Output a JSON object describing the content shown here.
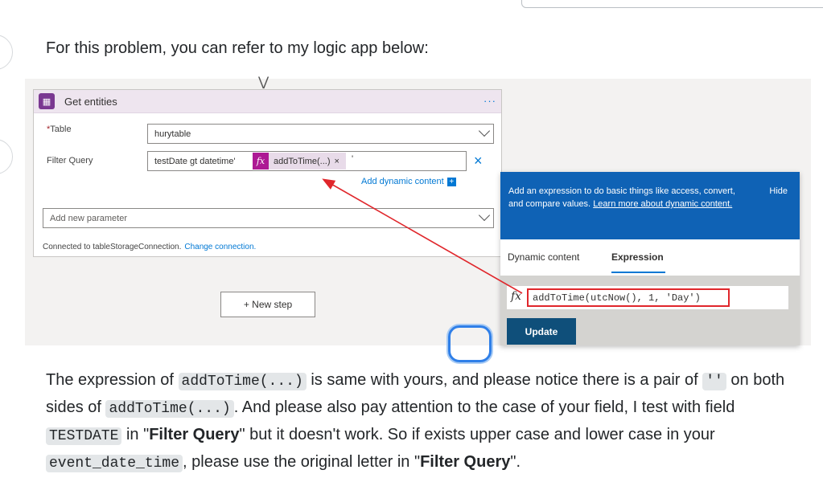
{
  "intro": "For this problem, you can refer to my logic app below:",
  "card": {
    "title": "Get entities",
    "more": "···",
    "table_required": "*",
    "table_label": "Table",
    "table_value": "hurytable",
    "filter_label": "Filter Query",
    "filter_prefix": "testDate gt datetime'",
    "token_fx": "fx",
    "token_label": "addToTime(...)",
    "token_close": "×",
    "filter_suffix": "'",
    "clear": "×",
    "add_dynamic": "Add dynamic content",
    "add_dynamic_plus": "+",
    "param_placeholder": "Add new parameter",
    "connected_text": "Connected to tableStorageConnection.",
    "change_connection": "Change connection."
  },
  "new_step": "+ New step",
  "panel": {
    "banner_text": "Add an expression to do basic things like access, convert, and compare values.",
    "learn_more": "Learn more about dynamic content.",
    "hide": "Hide",
    "tab_dynamic": "Dynamic content",
    "tab_expression": "Expression",
    "fx": "fx",
    "expression": "addToTime(utcNow(), 1, 'Day')",
    "update": "Update"
  },
  "paragraph": {
    "p1": "The expression of ",
    "c1": "addToTime(...)",
    "p2": " is same with yours, and please notice there is a pair of ",
    "c2": "''",
    "p3": " on both sides of ",
    "c3": "addToTime(...)",
    "p4": ". And please also pay attention to the case of your field, I test with field ",
    "c4": "TESTDATE",
    "p5": " in \"",
    "b1": "Filter Query",
    "p6": "\" but it doesn't work. So if exists upper case and lower case in your ",
    "c5": "event_date_time",
    "p7": ", please use the original letter in \"",
    "b2": "Filter Query",
    "p8": "\"."
  },
  "colors": {
    "accent": "#0078d4",
    "token": "#ad1994",
    "highlight_border": "#e0262b",
    "banner": "#0f62b5"
  }
}
